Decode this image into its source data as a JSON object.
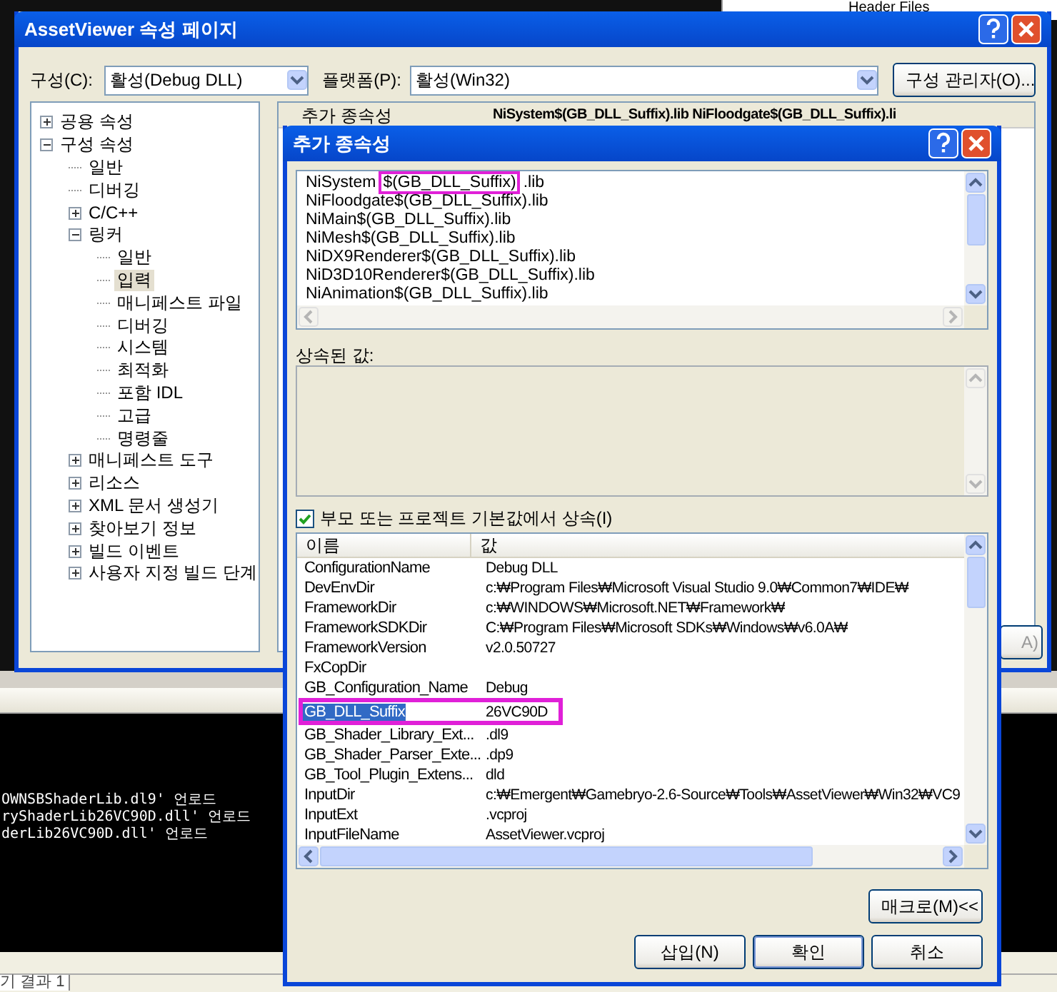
{
  "background": {
    "solution_tree_item": "Header Files",
    "output_lines": [
      "OWNSBShaderLib.dl9' 언로드",
      "ryShaderLib26VC90D.dll' 언로드",
      "derLib26VC90D.dll' 언로드"
    ],
    "output_tab": "기 결과 1"
  },
  "window": {
    "title": "AssetViewer 속성 페이지",
    "config_label": "구성(C):",
    "config_value": "활성(Debug DLL)",
    "platform_label": "플랫폼(P):",
    "platform_value": "활성(Win32)",
    "config_manager_button": "구성 관리자(O)...",
    "apply_button": "A)",
    "tree": [
      {
        "label": "공용 속성",
        "expanded": false,
        "selected": false
      },
      {
        "label": "구성 속성",
        "expanded": true,
        "selected": false,
        "children": [
          {
            "label": "일반",
            "selected": false
          },
          {
            "label": "디버깅",
            "selected": false
          },
          {
            "label": "C/C++",
            "expanded": false,
            "selected": false
          },
          {
            "label": "링커",
            "expanded": true,
            "selected": false,
            "children": [
              {
                "label": "일반",
                "selected": false
              },
              {
                "label": "입력",
                "selected": true
              },
              {
                "label": "매니페스트 파일",
                "selected": false
              },
              {
                "label": "디버깅",
                "selected": false
              },
              {
                "label": "시스템",
                "selected": false
              },
              {
                "label": "최적화",
                "selected": false
              },
              {
                "label": "포함 IDL",
                "selected": false
              },
              {
                "label": "고급",
                "selected": false
              },
              {
                "label": "명령줄",
                "selected": false
              }
            ]
          },
          {
            "label": "매니페스트 도구",
            "expanded": false,
            "selected": false
          },
          {
            "label": "리소스",
            "expanded": false,
            "selected": false
          },
          {
            "label": "XML 문서 생성기",
            "expanded": false,
            "selected": false
          },
          {
            "label": "찾아보기 정보",
            "expanded": false,
            "selected": false
          },
          {
            "label": "빌드 이벤트",
            "expanded": false,
            "selected": false
          },
          {
            "label": "사용자 지정 빌드 단계",
            "expanded": false,
            "selected": false
          }
        ]
      }
    ],
    "property": {
      "name": "추가 종속성",
      "value": "NiSystem$(GB_DLL_Suffix).lib NiFloodgate$(GB_DLL_Suffix).li"
    }
  },
  "dialog": {
    "title": "추가 종속성",
    "lines": [
      {
        "segments": [
          {
            "text": "NiSystem",
            "marked": false
          },
          {
            "text": "$(GB_DLL_Suffix)",
            "marked": true
          },
          {
            "text": ".lib",
            "marked": false
          }
        ]
      },
      {
        "segments": [
          {
            "text": "NiFloodgate$(GB_DLL_Suffix).lib",
            "marked": false
          }
        ]
      },
      {
        "segments": [
          {
            "text": "NiMain$(GB_DLL_Suffix).lib",
            "marked": false
          }
        ]
      },
      {
        "segments": [
          {
            "text": "NiMesh$(GB_DLL_Suffix).lib",
            "marked": false
          }
        ]
      },
      {
        "segments": [
          {
            "text": "NiDX9Renderer$(GB_DLL_Suffix).lib",
            "marked": false
          }
        ]
      },
      {
        "segments": [
          {
            "text": "NiD3D10Renderer$(GB_DLL_Suffix).lib",
            "marked": false
          }
        ]
      },
      {
        "segments": [
          {
            "text": "NiAnimation$(GB_DLL_Suffix).lib",
            "marked": false
          }
        ]
      }
    ],
    "inherited_label": "상속된 값:",
    "inherit_checkbox": {
      "label": "부모 또는 프로젝트 기본값에서 상속(I)",
      "checked": true
    },
    "macros": {
      "columns": [
        "이름",
        "값"
      ],
      "rows": [
        {
          "name": "ConfigurationName",
          "value": "Debug DLL",
          "selected": false,
          "marked": false
        },
        {
          "name": "DevEnvDir",
          "value": "c:₩Program Files₩Microsoft Visual Studio 9.0₩Common7₩IDE₩",
          "selected": false,
          "marked": false
        },
        {
          "name": "FrameworkDir",
          "value": "c:₩WINDOWS₩Microsoft.NET₩Framework₩",
          "selected": false,
          "marked": false
        },
        {
          "name": "FrameworkSDKDir",
          "value": "C:₩Program Files₩Microsoft SDKs₩Windows₩v6.0A₩",
          "selected": false,
          "marked": false
        },
        {
          "name": "FrameworkVersion",
          "value": "v2.0.50727",
          "selected": false,
          "marked": false
        },
        {
          "name": "FxCopDir",
          "value": "",
          "selected": false,
          "marked": false
        },
        {
          "name": "GB_Configuration_Name",
          "value": "Debug",
          "selected": false,
          "marked": false
        },
        {
          "name": "GB_DLL_Suffix",
          "value": "26VC90D",
          "selected": true,
          "marked": true
        },
        {
          "name": "GB_Shader_Library_Ext...",
          "value": ".dl9",
          "selected": false,
          "marked": false
        },
        {
          "name": "GB_Shader_Parser_Exte...",
          "value": ".dp9",
          "selected": false,
          "marked": false
        },
        {
          "name": "GB_Tool_Plugin_Extens...",
          "value": "dld",
          "selected": false,
          "marked": false
        },
        {
          "name": "InputDir",
          "value": "c:₩Emergent₩Gamebryo-2.6-Source₩Tools₩AssetViewer₩Win32₩VC9",
          "selected": false,
          "marked": false
        },
        {
          "name": "InputExt",
          "value": ".vcproj",
          "selected": false,
          "marked": false
        },
        {
          "name": "InputFileName",
          "value": "AssetViewer.vcproj",
          "selected": false,
          "marked": false
        }
      ]
    },
    "macro_button": "매크로(M)<<",
    "buttons": [
      "삽입(N)",
      "확인",
      "취소"
    ]
  }
}
